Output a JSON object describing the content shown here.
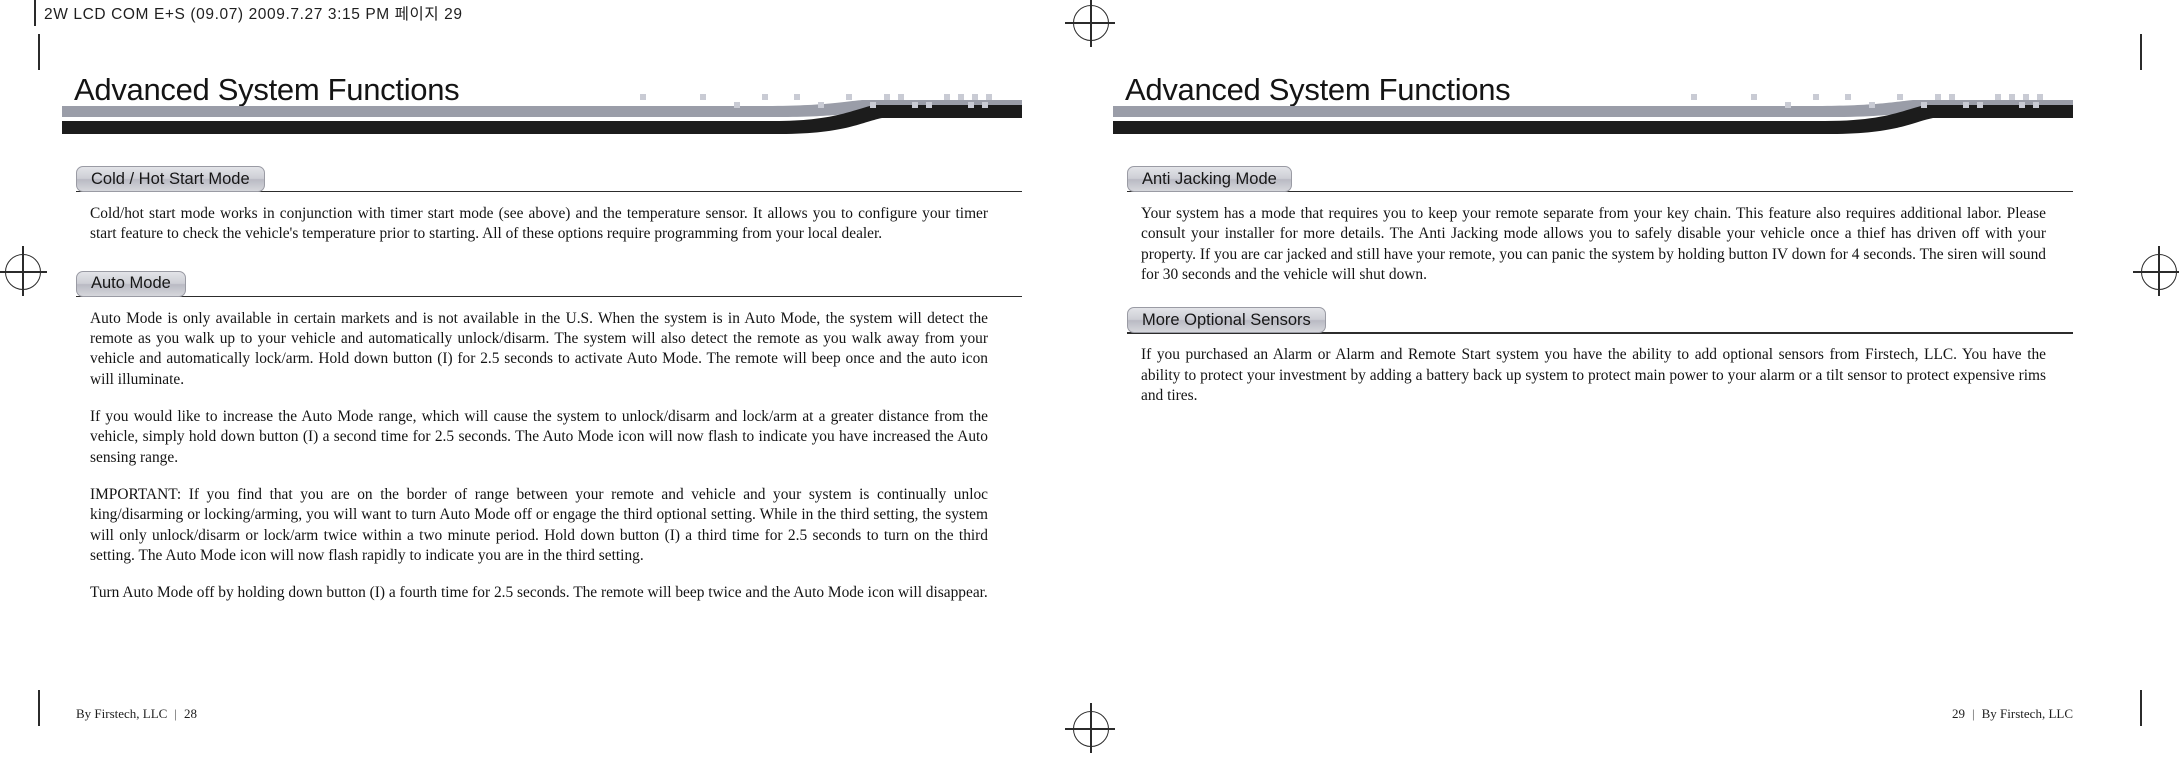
{
  "scan": {
    "header_text": "2W LCD COM E+S  (09.07)  2009.7.27 3:15 PM 페이지 29"
  },
  "pages": [
    {
      "banner_title": "Advanced System Functions",
      "folio": {
        "credit": "By Firstech, LLC",
        "bar": "|",
        "number": "28",
        "order": "credit-first"
      },
      "sections": [
        {
          "heading": "Cold / Hot Start Mode",
          "paragraphs": [
            "Cold/hot start mode works in conjunction with timer start mode (see above) and the temperature sensor.  It allows you to configure your timer start feature to check the vehicle's temperature prior to starting.  All of these options require programming from your local dealer."
          ]
        },
        {
          "heading": "Auto Mode",
          "paragraphs": [
            "Auto Mode is only available in certain markets and is not available in the U.S. When the system is in Auto Mode, the system will detect the remote as you walk up to your vehicle and automatically unlock/disarm. The system will also detect the remote as you walk away from your vehicle and automatically lock/arm. Hold down button (I) for 2.5 seconds to activate Auto Mode. The remote will beep once and the auto icon will illuminate.",
            "If you would like to increase the Auto Mode range, which will cause the system to unlock/disarm and lock/arm at a greater distance from the vehicle, simply hold down button (I) a second time for 2.5 seconds. The Auto Mode icon will now flash to indicate you have increased the Auto sensing range.",
            "IMPORTANT: If you find that you are on the border of range between your remote and vehicle and your system is continually unloc   king/disarming or locking/arming, you will want to turn Auto Mode off or engage the third optional setting. While in the third setting, the system will only unlock/disarm or lock/arm twice within a two minute period. Hold down button (I) a third time for 2.5 seconds to turn on the third setting. The Auto Mode icon will now flash rapidly to indicate you are in the third setting.",
            "Turn Auto Mode off by holding down button (I) a fourth time for 2.5 seconds. The remote will beep twice and the Auto Mode icon will disappear."
          ]
        }
      ]
    },
    {
      "banner_title": "Advanced System Functions",
      "folio": {
        "credit": "By Firstech, LLC",
        "bar": "|",
        "number": "29",
        "order": "number-first"
      },
      "sections": [
        {
          "heading": "Anti Jacking Mode",
          "paragraphs": [
            "Your system has a mode that requires you to keep your remote separate from your key chain. This feature also requires additional labor. Please consult your installer for more details. The Anti Jacking mode allows you to safely disable your vehicle once a thief has driven off with your property. If you are car jacked and still have your remote, you can panic the system by holding button IV down for 4 seconds. The siren will sound for 30 seconds and the vehicle will shut down."
          ]
        },
        {
          "heading": "More Optional Sensors",
          "paragraphs": [
            "If you purchased an Alarm or Alarm and Remote Start system you have the ability to add optional sensors from Firstech, LLC. You have the ability to protect your investment by adding a battery back up system to protect main power to your alarm or a tilt sensor to protect expensive rims and tires."
          ]
        }
      ]
    }
  ],
  "colors": {
    "swoosh_gray": "#9a9da8",
    "swoosh_black": "#1c1c1c",
    "pill_border": "#9a9ba4",
    "dot": "#c9cbd4"
  }
}
